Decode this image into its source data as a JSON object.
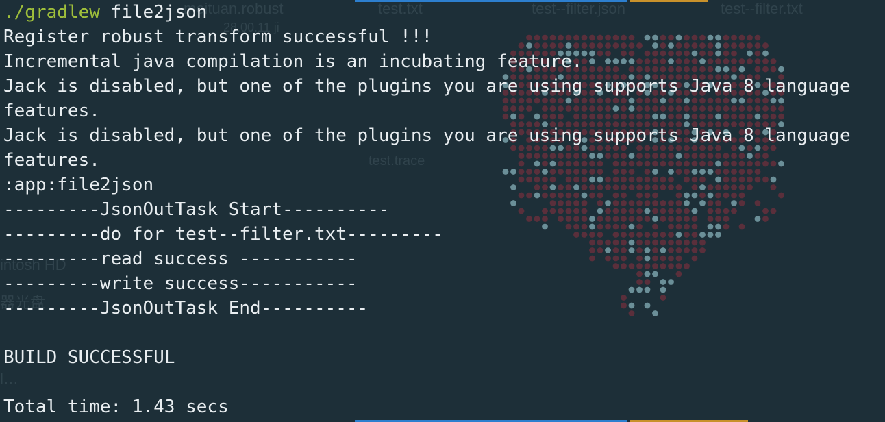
{
  "background": {
    "files": [
      "meituan.robust",
      "test.txt",
      "test--filter.json",
      "test--filter.txt",
      "test.trace"
    ],
    "file_date": "28.00.11 ji",
    "sidebar": [
      "intosh HD",
      "器光盘",
      "l…"
    ],
    "colors": {
      "base": "#1d2f38",
      "dot_dark": "#5a2f3b",
      "dot_light": "#6b8f98",
      "tab_blue": "#2d7fcf",
      "tab_gold": "#c8912b"
    }
  },
  "terminal": {
    "command_prefix": "./gradlew",
    "command_args": " file2json",
    "output": [
      "Register robust transform successful !!!",
      "Incremental java compilation is an incubating feature.",
      "Jack is disabled, but one of the plugins you are using supports Java 8 language",
      "features.",
      "Jack is disabled, but one of the plugins you are using supports Java 8 language",
      "features.",
      ":app:file2json",
      "---------JsonOutTask Start----------",
      "---------do for test--filter.txt---------",
      "---------read success -----------",
      "---------write success-----------",
      "---------JsonOutTask End----------",
      "",
      "BUILD SUCCESSFUL",
      "",
      "Total time: 1.43 secs"
    ],
    "colors": {
      "text": "#e9eef1",
      "command": "#9fbf3b"
    }
  }
}
